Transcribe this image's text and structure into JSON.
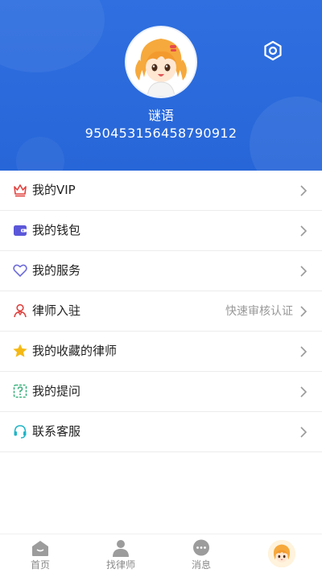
{
  "profile": {
    "nickname": "谜语",
    "user_id": "950453156458790912"
  },
  "menu": [
    {
      "label": "我的VIP",
      "icon": "crown-icon",
      "extra": ""
    },
    {
      "label": "我的钱包",
      "icon": "wallet-icon",
      "extra": ""
    },
    {
      "label": "我的服务",
      "icon": "heart-outline-icon",
      "extra": ""
    },
    {
      "label": "律师入驻",
      "icon": "lawyer-person-icon",
      "extra": "快速审核认证"
    },
    {
      "label": "我的收藏的律师",
      "icon": "star-icon",
      "extra": ""
    },
    {
      "label": "我的提问",
      "icon": "question-note-icon",
      "extra": ""
    },
    {
      "label": "联系客服",
      "icon": "headset-icon",
      "extra": ""
    }
  ],
  "tabbar": [
    {
      "label": "首页",
      "icon": "home-icon"
    },
    {
      "label": "找律师",
      "icon": "person-icon"
    },
    {
      "label": "消息",
      "icon": "chat-bubble-icon"
    },
    {
      "label": "",
      "icon": "avatar"
    }
  ],
  "colors": {
    "header_blue": "#2766d8",
    "crown_red": "#e0423f",
    "wallet_purple": "#5b57d9",
    "heart_blue": "#6e6cd9",
    "lawyer_red": "#e0423f",
    "star_yellow": "#f5b914",
    "question_green": "#3fb27f",
    "headset_teal": "#21b5c7"
  }
}
